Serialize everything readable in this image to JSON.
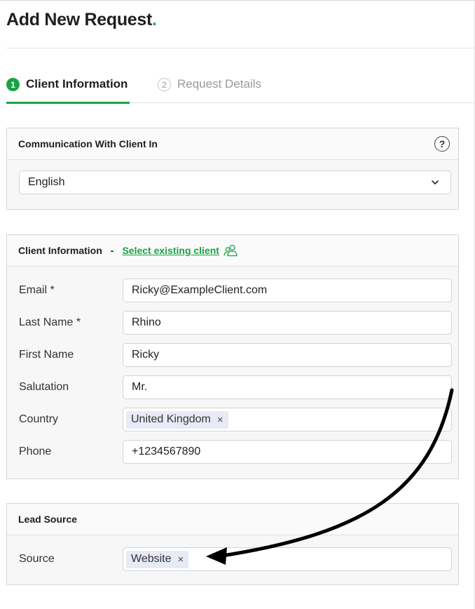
{
  "page": {
    "title": "Add New Request",
    "title_dot": "."
  },
  "tabs": [
    {
      "num": "1",
      "label": "Client Information",
      "active": true
    },
    {
      "num": "2",
      "label": "Request Details",
      "active": false
    }
  ],
  "communication": {
    "heading": "Communication With Client In",
    "help_icon": "question-circle-icon",
    "language_value": "English"
  },
  "client": {
    "heading": "Client Information",
    "separator": "-",
    "select_existing": "Select existing client",
    "fields": {
      "email": {
        "label": "Email *",
        "value": "Ricky@ExampleClient.com"
      },
      "last_name": {
        "label": "Last Name *",
        "value": "Rhino"
      },
      "first_name": {
        "label": "First Name",
        "value": "Ricky"
      },
      "salutation": {
        "label": "Salutation",
        "value": "Mr."
      },
      "country": {
        "label": "Country",
        "chip": "United Kingdom",
        "remove": "×"
      },
      "phone": {
        "label": "Phone",
        "value": "+1234567890"
      }
    }
  },
  "lead_source": {
    "heading": "Lead Source",
    "source": {
      "label": "Source",
      "chip": "Website",
      "remove": "×"
    }
  },
  "colors": {
    "accent": "#1aa345",
    "chip_bg": "#e8ebf6",
    "arrow": "#000000"
  }
}
